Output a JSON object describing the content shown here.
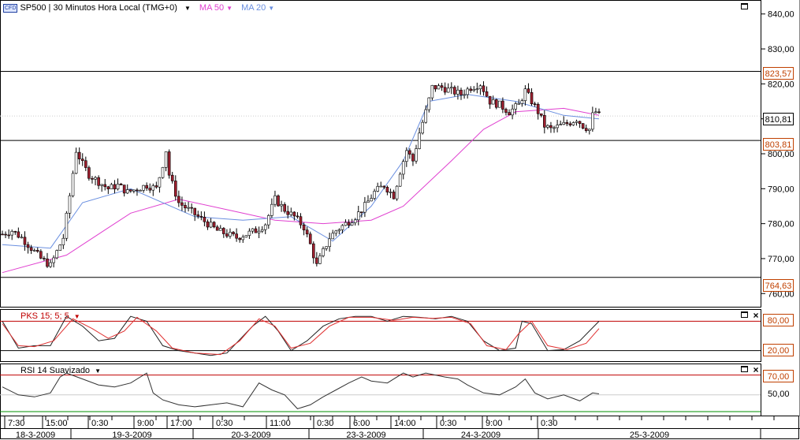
{
  "header": {
    "badge": "CFD",
    "instrument": "SP500 | 30 Minutos Hora Local (TMG+0)",
    "ma50_label": "MA 50",
    "ma20_label": "MA 20"
  },
  "price_boxes": {
    "resistance": "823,57",
    "last": "810,81",
    "support1": "803,81",
    "support2": "764,63"
  },
  "pks": {
    "label": "PKS 15; 5; 5",
    "upper": "80,00",
    "lower": "20,00"
  },
  "rsi": {
    "label": "RSI 14 Suavizado",
    "upper": "70,00",
    "mid": "50,00"
  },
  "time_axis": {
    "hours": [
      "7:30",
      "15:00",
      "0:30",
      "9:00",
      "17:00",
      "0:30",
      "11:00",
      "0:30",
      "6:00",
      "14:00",
      "0:30",
      "9:00",
      "0:30"
    ],
    "dates": [
      "18-3-2009",
      "19-3-2009",
      "20-3-2009",
      "23-3-2009",
      "24-3-2009",
      "25-3-2009"
    ]
  },
  "colors": {
    "ma50": "#e040d0",
    "ma20": "#6a8fe0",
    "pks_signal": "#e03030",
    "level_line": "#c00000",
    "price_text": "#c04000"
  },
  "chart_data": [
    {
      "type": "candlestick",
      "title": "SP500 | 30 Minutos Hora Local (TMG+0)",
      "ylim": [
        756,
        844
      ],
      "yticks": [
        "760,00",
        "770,00",
        "780,00",
        "790,00",
        "800,00",
        "810,00",
        "820,00",
        "830,00",
        "840,00"
      ],
      "levels": [
        823.57,
        803.81,
        764.63
      ],
      "last": 810.81,
      "close_path": [
        [
          0,
          777
        ],
        [
          3,
          778
        ],
        [
          6,
          776
        ],
        [
          9,
          773
        ],
        [
          12,
          770
        ],
        [
          15,
          768
        ],
        [
          17,
          772
        ],
        [
          19,
          776
        ],
        [
          21,
          788
        ],
        [
          23,
          801
        ],
        [
          25,
          797
        ],
        [
          27,
          794
        ],
        [
          30,
          792
        ],
        [
          33,
          790
        ],
        [
          36,
          791
        ],
        [
          39,
          789
        ],
        [
          42,
          790
        ],
        [
          45,
          791
        ],
        [
          48,
          790
        ],
        [
          50,
          797
        ],
        [
          51,
          801
        ],
        [
          52,
          794
        ],
        [
          55,
          786
        ],
        [
          58,
          784
        ],
        [
          61,
          782
        ],
        [
          64,
          780
        ],
        [
          67,
          778
        ],
        [
          70,
          777
        ],
        [
          73,
          776
        ],
        [
          76,
          777
        ],
        [
          79,
          778
        ],
        [
          82,
          780
        ],
        [
          85,
          787
        ],
        [
          88,
          784
        ],
        [
          91,
          782
        ],
        [
          94,
          779
        ],
        [
          96,
          774
        ],
        [
          98,
          768
        ],
        [
          100,
          772
        ],
        [
          102,
          776
        ],
        [
          104,
          778
        ],
        [
          107,
          780
        ],
        [
          110,
          782
        ],
        [
          113,
          785
        ],
        [
          116,
          789
        ],
        [
          119,
          791
        ],
        [
          122,
          788
        ],
        [
          124,
          795
        ],
        [
          126,
          801
        ],
        [
          128,
          798
        ],
        [
          130,
          806
        ],
        [
          132,
          812
        ],
        [
          134,
          819
        ],
        [
          137,
          819
        ],
        [
          140,
          818
        ],
        [
          143,
          817
        ],
        [
          146,
          819
        ],
        [
          149,
          820
        ],
        [
          152,
          815
        ],
        [
          155,
          814
        ],
        [
          158,
          812
        ],
        [
          161,
          814
        ],
        [
          163,
          818
        ],
        [
          165,
          815
        ],
        [
          167,
          812
        ],
        [
          169,
          808
        ],
        [
          171,
          807
        ],
        [
          174,
          808
        ],
        [
          177,
          809
        ],
        [
          179,
          810
        ],
        [
          181,
          808
        ],
        [
          183,
          807
        ],
        [
          184,
          811
        ],
        [
          185,
          812
        ],
        [
          186,
          811
        ]
      ],
      "series": [
        {
          "name": "MA 50",
          "values": [
            [
              0,
              766
            ],
            [
              20,
              771
            ],
            [
              40,
              783
            ],
            [
              55,
              787
            ],
            [
              70,
              784
            ],
            [
              85,
              781
            ],
            [
              100,
              780
            ],
            [
              115,
              781
            ],
            [
              125,
              785
            ],
            [
              140,
              798
            ],
            [
              150,
              807
            ],
            [
              160,
              812
            ],
            [
              175,
              813
            ],
            [
              186,
              811
            ]
          ]
        },
        {
          "name": "MA 20",
          "values": [
            [
              0,
              774
            ],
            [
              15,
              773
            ],
            [
              25,
              786
            ],
            [
              40,
              790
            ],
            [
              60,
              782
            ],
            [
              75,
              781
            ],
            [
              90,
              782
            ],
            [
              103,
              775
            ],
            [
              115,
              785
            ],
            [
              125,
              798
            ],
            [
              133,
              815
            ],
            [
              145,
              817
            ],
            [
              160,
              815
            ],
            [
              175,
              811
            ],
            [
              186,
              810
            ]
          ]
        }
      ]
    },
    {
      "type": "line",
      "title": "PKS 15; 5; 5",
      "ylim": [
        0,
        100
      ],
      "levels": [
        80,
        20
      ],
      "series": [
        {
          "name": "PKS",
          "values": [
            [
              0,
              80
            ],
            [
              5,
              25
            ],
            [
              10,
              30
            ],
            [
              15,
              30
            ],
            [
              20,
              90
            ],
            [
              25,
              70
            ],
            [
              30,
              40
            ],
            [
              35,
              45
            ],
            [
              40,
              90
            ],
            [
              45,
              80
            ],
            [
              50,
              30
            ],
            [
              55,
              20
            ],
            [
              65,
              10
            ],
            [
              70,
              15
            ],
            [
              78,
              70
            ],
            [
              82,
              90
            ],
            [
              86,
              60
            ],
            [
              90,
              20
            ],
            [
              95,
              40
            ],
            [
              100,
              70
            ],
            [
              105,
              85
            ],
            [
              110,
              90
            ],
            [
              115,
              90
            ],
            [
              120,
              80
            ],
            [
              125,
              90
            ],
            [
              130,
              88
            ],
            [
              135,
              85
            ],
            [
              140,
              90
            ],
            [
              145,
              80
            ],
            [
              150,
              40
            ],
            [
              155,
              20
            ],
            [
              160,
              25
            ],
            [
              162,
              80
            ],
            [
              165,
              75
            ],
            [
              170,
              20
            ],
            [
              175,
              22
            ],
            [
              180,
              40
            ],
            [
              186,
              80
            ]
          ]
        },
        {
          "name": "signal",
          "values": [
            [
              0,
              75
            ],
            [
              5,
              30
            ],
            [
              10,
              28
            ],
            [
              16,
              40
            ],
            [
              22,
              85
            ],
            [
              28,
              65
            ],
            [
              33,
              45
            ],
            [
              38,
              60
            ],
            [
              42,
              88
            ],
            [
              48,
              60
            ],
            [
              53,
              25
            ],
            [
              60,
              15
            ],
            [
              68,
              12
            ],
            [
              74,
              40
            ],
            [
              80,
              85
            ],
            [
              85,
              70
            ],
            [
              90,
              25
            ],
            [
              96,
              35
            ],
            [
              102,
              70
            ],
            [
              108,
              88
            ],
            [
              115,
              88
            ],
            [
              122,
              82
            ],
            [
              128,
              88
            ],
            [
              134,
              86
            ],
            [
              140,
              88
            ],
            [
              146,
              75
            ],
            [
              151,
              30
            ],
            [
              157,
              22
            ],
            [
              161,
              55
            ],
            [
              165,
              80
            ],
            [
              170,
              30
            ],
            [
              176,
              22
            ],
            [
              182,
              35
            ],
            [
              186,
              65
            ]
          ]
        }
      ]
    },
    {
      "type": "line",
      "title": "RSI 14 Suavizado",
      "ylim": [
        30,
        80
      ],
      "levels": [
        70,
        50
      ],
      "series": [
        {
          "name": "RSI 14",
          "values": [
            [
              0,
              58
            ],
            [
              5,
              50
            ],
            [
              10,
              48
            ],
            [
              15,
              52
            ],
            [
              18,
              68
            ],
            [
              20,
              72
            ],
            [
              25,
              66
            ],
            [
              30,
              60
            ],
            [
              35,
              58
            ],
            [
              40,
              62
            ],
            [
              45,
              72
            ],
            [
              47,
              52
            ],
            [
              50,
              45
            ],
            [
              55,
              40
            ],
            [
              60,
              38
            ],
            [
              65,
              40
            ],
            [
              70,
              42
            ],
            [
              75,
              38
            ],
            [
              80,
              62
            ],
            [
              84,
              55
            ],
            [
              88,
              50
            ],
            [
              92,
              36
            ],
            [
              96,
              40
            ],
            [
              100,
              48
            ],
            [
              104,
              55
            ],
            [
              108,
              62
            ],
            [
              112,
              68
            ],
            [
              115,
              64
            ],
            [
              120,
              62
            ],
            [
              125,
              72
            ],
            [
              128,
              68
            ],
            [
              132,
              72
            ],
            [
              138,
              68
            ],
            [
              142,
              66
            ],
            [
              145,
              60
            ],
            [
              150,
              52
            ],
            [
              155,
              50
            ],
            [
              160,
              58
            ],
            [
              163,
              66
            ],
            [
              166,
              52
            ],
            [
              170,
              46
            ],
            [
              175,
              50
            ],
            [
              180,
              44
            ],
            [
              184,
              52
            ],
            [
              186,
              51
            ]
          ]
        }
      ]
    }
  ]
}
